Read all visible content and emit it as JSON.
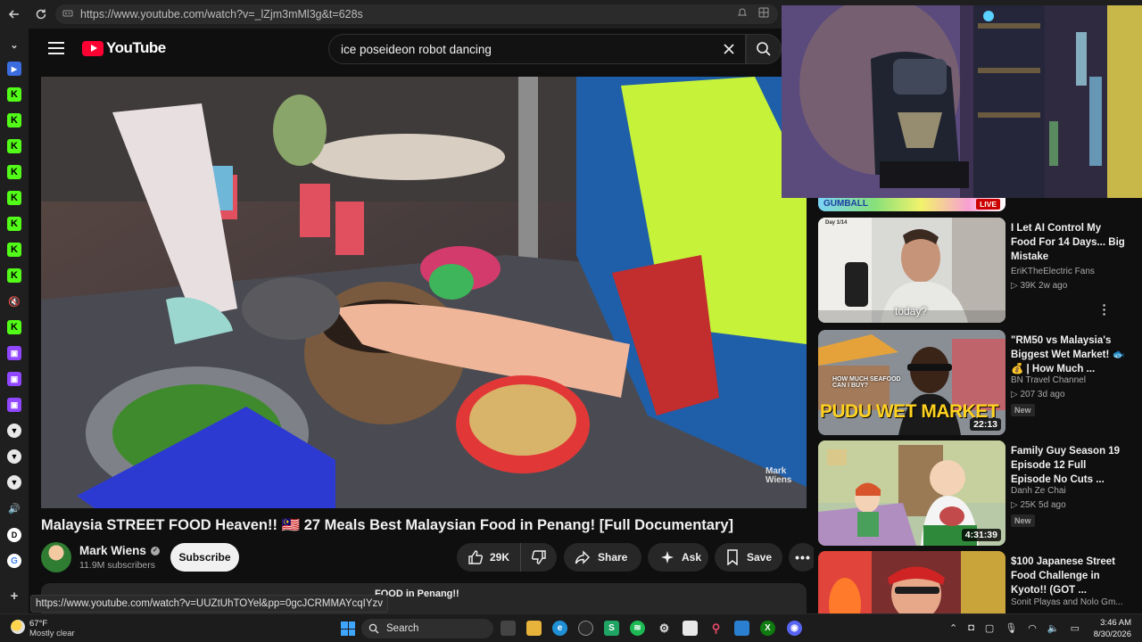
{
  "browser": {
    "url": "https://www.youtube.com/watch?v=_lZjm3mMl3g&t=628s"
  },
  "youtube": {
    "logo_text": "YouTube",
    "search_query": "ice poseideon robot dancing"
  },
  "video": {
    "title": "Malaysia STREET FOOD Heaven!! 🇲🇾 27 Meals Best Malaysian Food in Penang! [Full Documentary]",
    "watermark": "Mark Wiens",
    "channel": "Mark Wiens",
    "subscribers": "11.9M subscribers",
    "subscribe_label": "Subscribe",
    "likes": "29K",
    "share_label": "Share",
    "ask_label": "Ask",
    "save_label": "Save",
    "description_peek": "FOOD in Penang!!"
  },
  "status_bar_url": "https://www.youtube.com/watch?v=UUZtUhTOYel&pp=0gcJCRMMAYcqIYzv",
  "live_strip": {
    "label": "GUMBALL",
    "badge": "LIVE"
  },
  "recommendations": [
    {
      "title": "I Let AI Control My Food For 14 Days... Big Mistake",
      "channel": "EriKTheElectric Fans",
      "meta": "▷ 39K  2w ago",
      "caption": "today?",
      "corner_label": "Day 1/14",
      "duration": "",
      "new": ""
    },
    {
      "title": "\"RM50 vs Malaysia's Biggest Wet Market! 🐟💰 | How Much ...",
      "channel": "BN Travel Channel",
      "meta": "▷ 207  3d ago",
      "thumb_text": "PUDU WET MARKET",
      "thumb_sub": "HOW MUCH SEAFOOD CAN I BUY?",
      "duration": "22:13",
      "new": "New"
    },
    {
      "title": "Family Guy Season 19 Episode 12 Full Episode No Cuts ...",
      "channel": "Danh Ze Chai",
      "meta": "▷ 25K  5d ago",
      "duration": "4:31:39",
      "new": "New"
    },
    {
      "title": "$100 Japanese Street Food Challenge in Kyoto!! (GOT ...",
      "channel": "Sonit Playas and Nolo Gm...",
      "meta": "",
      "duration": "",
      "new": ""
    }
  ],
  "taskbar": {
    "temperature": "67°F",
    "weather": "Mostly clear",
    "search_label": "Search",
    "time": "3:46 AM",
    "date": "8/30/2026"
  },
  "colors": {
    "youtube_red": "#ff0033",
    "background": "#0f0f0f",
    "pill_bg": "#272727"
  }
}
